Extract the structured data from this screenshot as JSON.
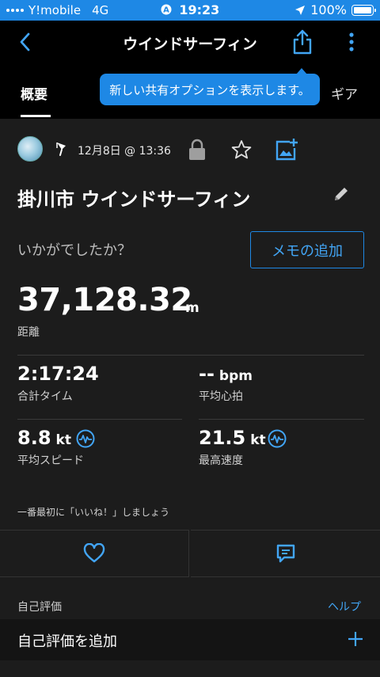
{
  "status_bar": {
    "carrier": "Y!mobile",
    "network": "4G",
    "time": "19:23",
    "battery": "100%",
    "color": "#1e88e5"
  },
  "nav": {
    "title": "ウインドサーフィン",
    "back_icon": "chevron-left-icon",
    "share_icon": "share-icon",
    "more_icon": "more-vertical-icon"
  },
  "tabs": {
    "overview": "概要",
    "gear": "ギア"
  },
  "tooltip": "新しい共有オプションを表示します。",
  "activity": {
    "date": "12月8日 @ 13:36",
    "title": "掛川市 ウインドサーフィン",
    "question": "いかがでしたか？",
    "memo_button": "メモの追加"
  },
  "stats": {
    "distance": {
      "value": "37,128.32",
      "unit": "m",
      "label": "距離"
    },
    "total_time": {
      "value": "2:17:24",
      "label": "合計タイム"
    },
    "avg_hr": {
      "value": "--",
      "unit": "bpm",
      "label": "平均心拍"
    },
    "avg_speed": {
      "value": "8.8",
      "unit": "kt",
      "label": "平均スピード"
    },
    "max_speed": {
      "value": "21.5",
      "unit": "kt",
      "label": "最高速度"
    }
  },
  "social": {
    "like_prompt": "一番最初に「いいね！」しましょう"
  },
  "self_eval": {
    "section_label": "自己評価",
    "help": "ヘルプ",
    "add_label": "自己評価を追加"
  },
  "colors": {
    "accent": "#1e88e5",
    "link": "#42a5f5",
    "background": "#1c1c1c"
  }
}
